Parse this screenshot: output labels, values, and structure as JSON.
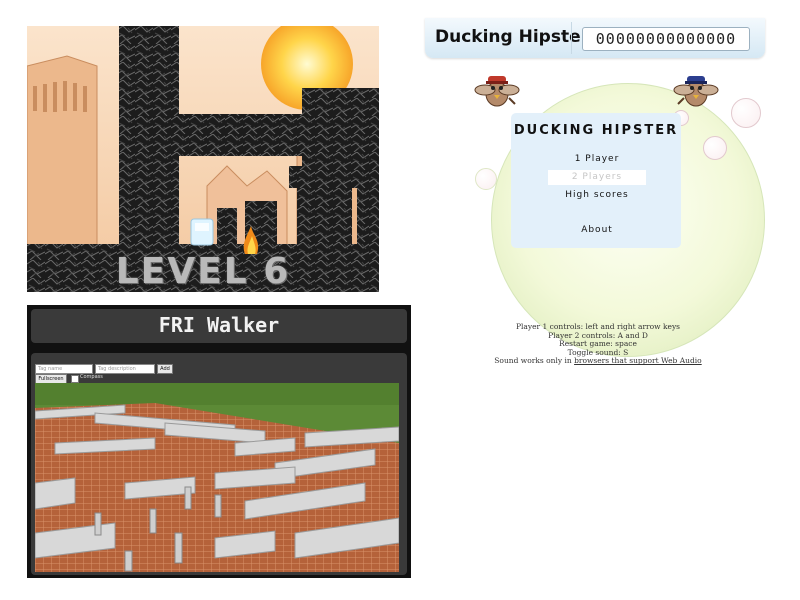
{
  "level_game": {
    "level_label": "LEVEL 6"
  },
  "ducking_hipster": {
    "header_title": "Ducking Hipster",
    "score": "00000000000000",
    "menu_title": "DUCKING HIPSTER",
    "menu_items": [
      "1 Player",
      "2 Players",
      "High scores",
      "About"
    ],
    "instructions": [
      "Player 1 controls: left and right arrow keys",
      "Player 2 controls: A and D",
      "Restart game: space",
      "Toggle sound: S"
    ],
    "sound_note_prefix": "Sound works only in ",
    "sound_note_link": "browsers that support Web Audio",
    "colors": {
      "header_bg": "#e3f0fa",
      "menu_bg": "#e3f0fa",
      "bubble": "#eef6d2"
    }
  },
  "fri_walker": {
    "title": "FRI Walker",
    "tag_name_placeholder": "Tag name",
    "tag_description_placeholder": "Tag description",
    "add_button": "Add",
    "fullscreen_button": "Fullscreen",
    "compass_label": "Compass",
    "colors": {
      "panel_bg": "#111111",
      "header_bg": "#3a3a3a",
      "floor": "#b5623a",
      "walls": "#d8d8d8",
      "grass": "#5c8a36"
    }
  }
}
